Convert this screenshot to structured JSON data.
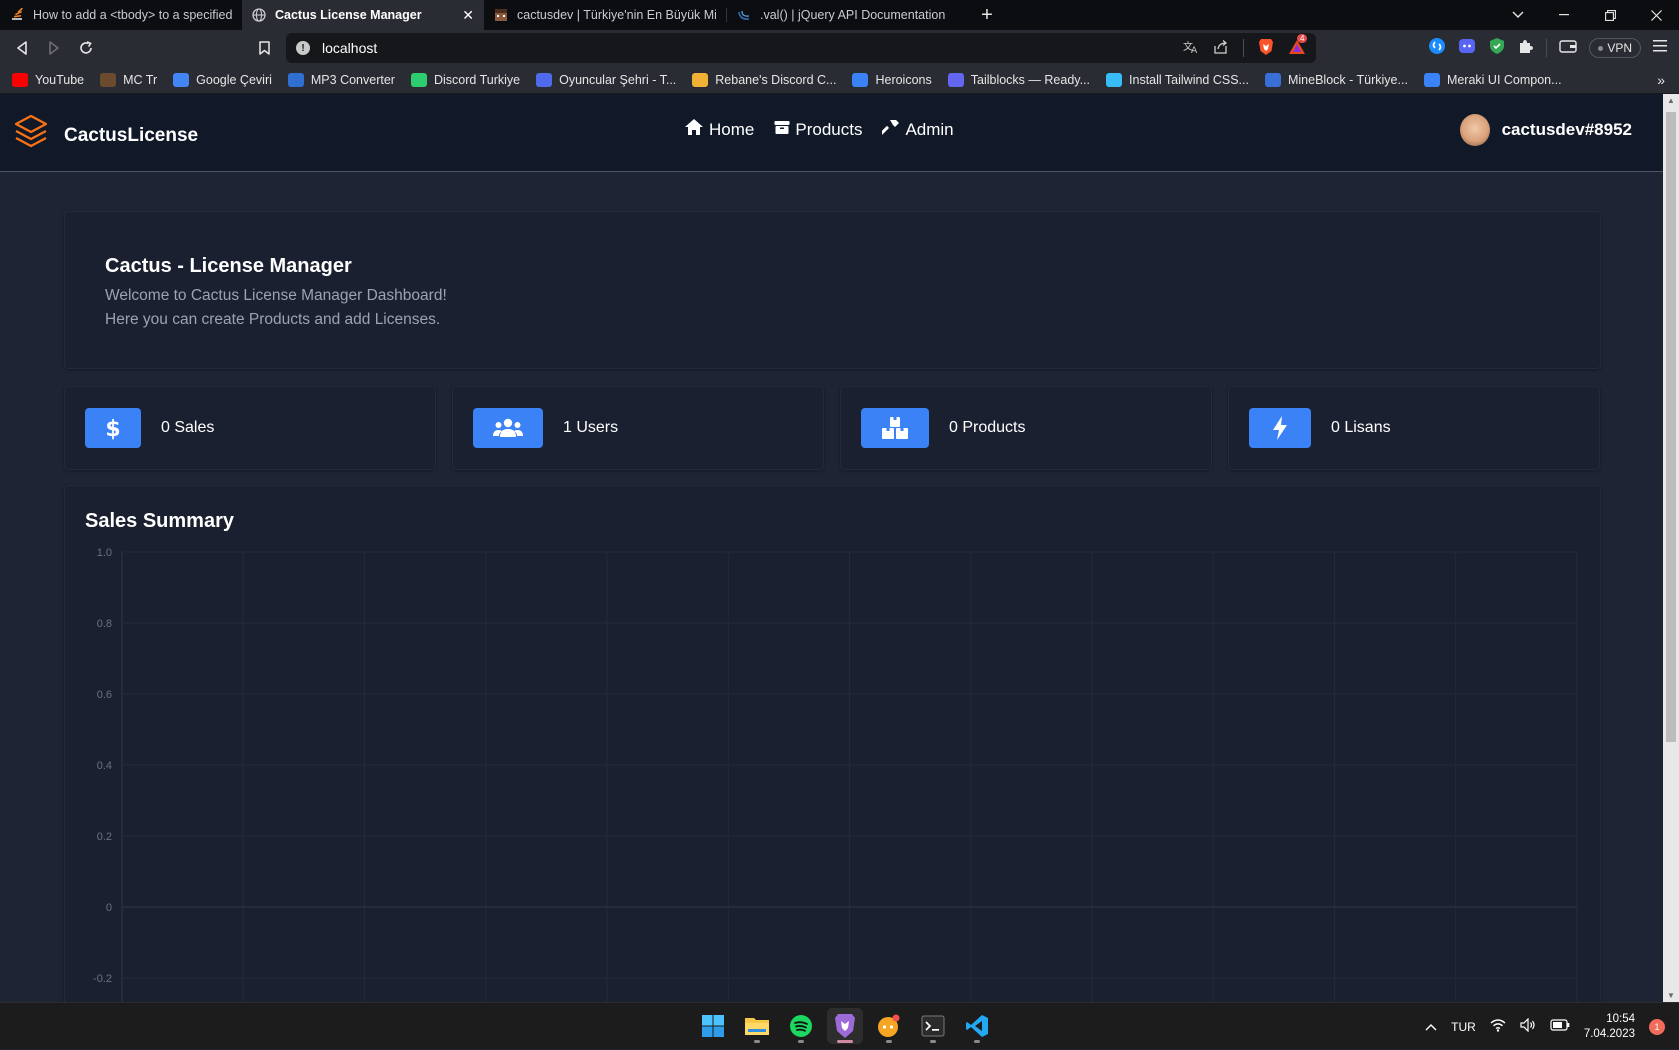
{
  "browser": {
    "tabs": [
      {
        "title": "How to add a <tbody> to a specified",
        "icon": "stackoverflow-icon",
        "active": false
      },
      {
        "title": "Cactus License Manager",
        "icon": "globe-icon",
        "active": true
      },
      {
        "title": "cactusdev | Türkiye'nin En Büyük Mine",
        "icon": "minecraft-icon",
        "active": false
      },
      {
        "title": ".val() | jQuery API Documentation",
        "icon": "jquery-icon",
        "active": false
      }
    ],
    "new_tab_label": "+",
    "close_tab_label": "✕",
    "address": "localhost",
    "vpn_label": "VPN",
    "brave_badge": "4",
    "bookmarks": [
      {
        "label": "YouTube",
        "icon": "youtube-icon",
        "color": "#ff0000"
      },
      {
        "label": "MC Tr",
        "icon": "mctr-icon",
        "color": "#6b4a2f"
      },
      {
        "label": "Google Çeviri",
        "icon": "translate-icon",
        "color": "#4285f4"
      },
      {
        "label": "MP3 Converter",
        "icon": "play-icon",
        "color": "#2f6fd1"
      },
      {
        "label": "Discord Turkiye",
        "icon": "discord-tr-icon",
        "color": "#2ecc71"
      },
      {
        "label": "Oyuncular Şehri - T...",
        "icon": "oyuncular-icon",
        "color": "#4f6bed"
      },
      {
        "label": "Rebane's Discord C...",
        "icon": "fox-icon",
        "color": "#f2b134"
      },
      {
        "label": "Heroicons",
        "icon": "heroicons-icon",
        "color": "#3b82f6"
      },
      {
        "label": "Tailblocks — Ready...",
        "icon": "tailblocks-icon",
        "color": "#6366f1"
      },
      {
        "label": "Install Tailwind CSS...",
        "icon": "tailwind-icon",
        "color": "#38bdf8"
      },
      {
        "label": "MineBlock - Türkiye...",
        "icon": "mineblock-icon",
        "color": "#3b6fd8"
      },
      {
        "label": "Meraki UI Compon...",
        "icon": "meraki-icon",
        "color": "#3b82f6"
      }
    ],
    "more_bookmarks": "»"
  },
  "app": {
    "brand": "CactusLicense",
    "nav": [
      {
        "label": "Home",
        "icon": "home-icon"
      },
      {
        "label": "Products",
        "icon": "box-icon"
      },
      {
        "label": "Admin",
        "icon": "hammer-icon"
      }
    ],
    "username": "cactusdev#8952",
    "welcome": {
      "title": "Cactus - License Manager",
      "line1": "Welcome to Cactus License Manager Dashboard!",
      "line2": "Here you can create Products and add Licenses."
    },
    "stats": [
      {
        "label": "0 Sales",
        "icon": "dollar-icon"
      },
      {
        "label": "1 Users",
        "icon": "users-icon"
      },
      {
        "label": "0 Products",
        "icon": "boxes-icon"
      },
      {
        "label": "0 Lisans",
        "icon": "bolt-icon"
      }
    ],
    "accent_color": "#3b82f6"
  },
  "sales_summary": {
    "title": "Sales Summary"
  },
  "chart_data": {
    "type": "line",
    "title": "Sales Summary",
    "series": [],
    "xlabel": "",
    "ylabel": "",
    "ylim": [
      -0.2,
      1.0
    ],
    "y_ticks": [
      "1.0",
      "0.8",
      "0.6",
      "0.4",
      "0.2",
      "0",
      "-0.2"
    ],
    "grid": true
  },
  "taskbar": {
    "apps": [
      "windows-start-icon",
      "file-explorer-icon",
      "spotify-icon",
      "brave-icon",
      "discord-icon",
      "terminal-icon",
      "vscode-icon"
    ],
    "language": "TUR",
    "time": "10:54",
    "date": "7.04.2023",
    "notification_count": "1"
  }
}
